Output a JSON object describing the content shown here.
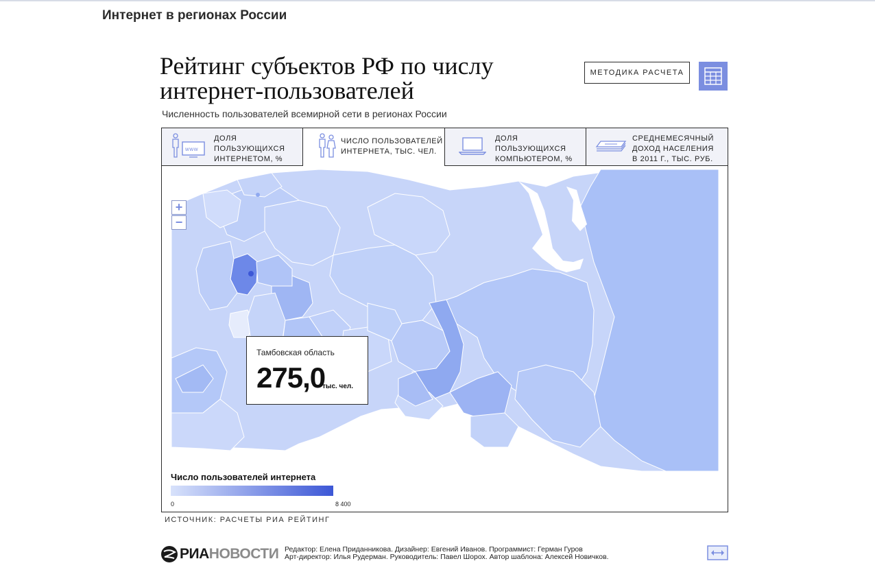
{
  "site_title": "Интернет в регионах России",
  "headline": {
    "line1": "Рейтинг субъектов РФ по числу",
    "line2": "интернет-пользователей"
  },
  "subtitle": "Численность пользователей всемирной сети в регионах России",
  "method_button_label": "МЕТОДИКА РАСЧЕТА",
  "tabs": [
    {
      "line1": "ДОЛЯ",
      "line2": "ПОЛЬЗУЮЩИХСЯ",
      "line3": "ИНТЕРНЕТОМ, %",
      "icon": "users-computer-icon"
    },
    {
      "line1": "ЧИСЛО ПОЛЬЗОВАТЕЛЕЙ",
      "line2": "ИНТЕРНЕТА, ТЫС. ЧЕЛ.",
      "line3": "",
      "icon": "users-icon"
    },
    {
      "line1": "ДОЛЯ",
      "line2": "ПОЛЬЗУЮЩИХСЯ",
      "line3": "КОМПЬЮТЕРОМ, %",
      "icon": "laptop-icon"
    },
    {
      "line1": "СРЕДНЕМЕСЯЧНЫЙ",
      "line2": "ДОХОД НАСЕЛЕНИЯ",
      "line3": "В 2011 Г., ТЫС. РУБ.",
      "icon": "money-icon"
    }
  ],
  "active_tab": 1,
  "zoom": {
    "in_label": "+",
    "out_label": "−"
  },
  "tooltip": {
    "region": "Тамбовская область",
    "value": "275,0",
    "unit": "тыс. чел."
  },
  "legend": {
    "title": "Число пользователей интернета",
    "min": "0",
    "max": "8 400",
    "color_min": "#d8e2fb",
    "color_max": "#3c57d6"
  },
  "source": "ИСТОЧНИК: РАСЧЕТЫ РИА РЕЙТИНГ",
  "logo": {
    "part1": "РИА",
    "part2": "НОВОСТИ"
  },
  "credits": {
    "line1": "Редактор: Елена Приданникова. Дизайнер: Евгений Иванов. Программист: Герман Гуров",
    "line2": "Арт-директор: Илья Рудерман. Руководитель: Павел Шорох. Автор шаблона: Алексей Новичков."
  },
  "colors": {
    "accent": "#7b8ee0",
    "map_base": "#bccdf7",
    "map_highlight": "#5f7ee6"
  }
}
